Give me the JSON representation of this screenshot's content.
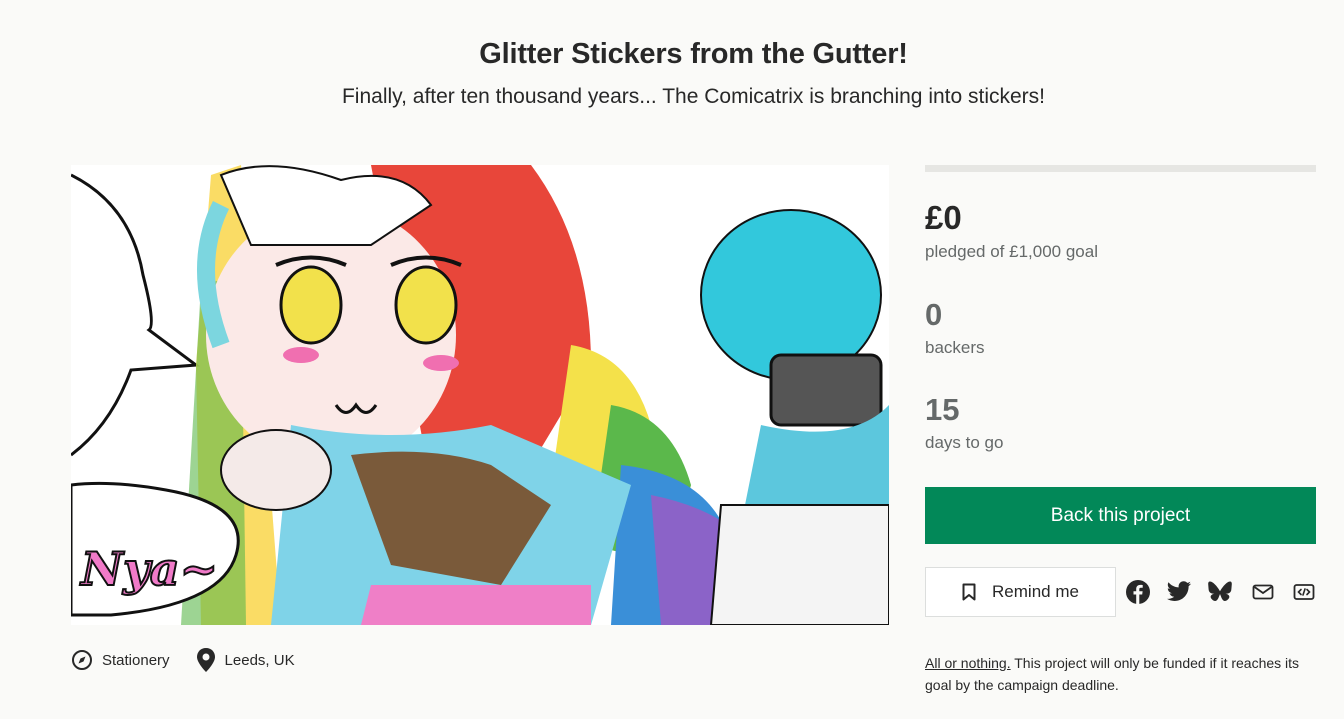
{
  "project": {
    "title": "Glitter Stickers from the Gutter!",
    "blurb": "Finally, after ten thousand years... The Comicatrix is branching into stickers!"
  },
  "hero": {
    "speech_text": "Nya~"
  },
  "meta": {
    "category": "Stationery",
    "location": "Leeds, UK"
  },
  "funding": {
    "progress_fraction": 0,
    "pledged": "£0",
    "pledged_label": "pledged of £1,000 goal",
    "backers": "0",
    "backers_label": "backers",
    "days": "15",
    "days_label": "days to go"
  },
  "actions": {
    "back_label": "Back this project",
    "remind_label": "Remind me"
  },
  "share_icons": [
    "facebook-icon",
    "twitter-icon",
    "bluesky-icon",
    "email-icon",
    "embed-icon"
  ],
  "note": {
    "link": "All or nothing.",
    "text": " This project will only be funded if it reaches its goal by the campaign deadline."
  }
}
